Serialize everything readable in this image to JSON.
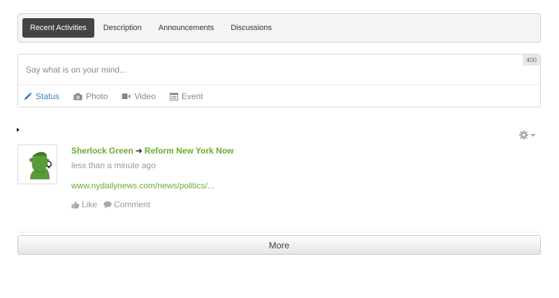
{
  "tabs": [
    {
      "label": "Recent Activities",
      "active": true
    },
    {
      "label": "Description",
      "active": false
    },
    {
      "label": "Announcements",
      "active": false
    },
    {
      "label": "Discussions",
      "active": false
    }
  ],
  "composer": {
    "placeholder": "Say what is on your mind...",
    "char_limit": "400",
    "types": [
      {
        "label": "Status",
        "icon": "pencil-icon",
        "active": true
      },
      {
        "label": "Photo",
        "icon": "camera-icon",
        "active": false
      },
      {
        "label": "Video",
        "icon": "video-camera-icon",
        "active": false
      },
      {
        "label": "Event",
        "icon": "calendar-icon",
        "active": false
      }
    ]
  },
  "post": {
    "author": "Sherlock Green",
    "target": "Reform New York Now",
    "time": "less than a minute ago",
    "link": "www.nydailynews.com/news/politics/...",
    "like_label": "Like",
    "comment_label": "Comment"
  },
  "more_label": "More",
  "colors": {
    "accent_blue": "#3b7fc4",
    "link_green": "#6aaa2f",
    "tab_active_bg": "#444444"
  }
}
